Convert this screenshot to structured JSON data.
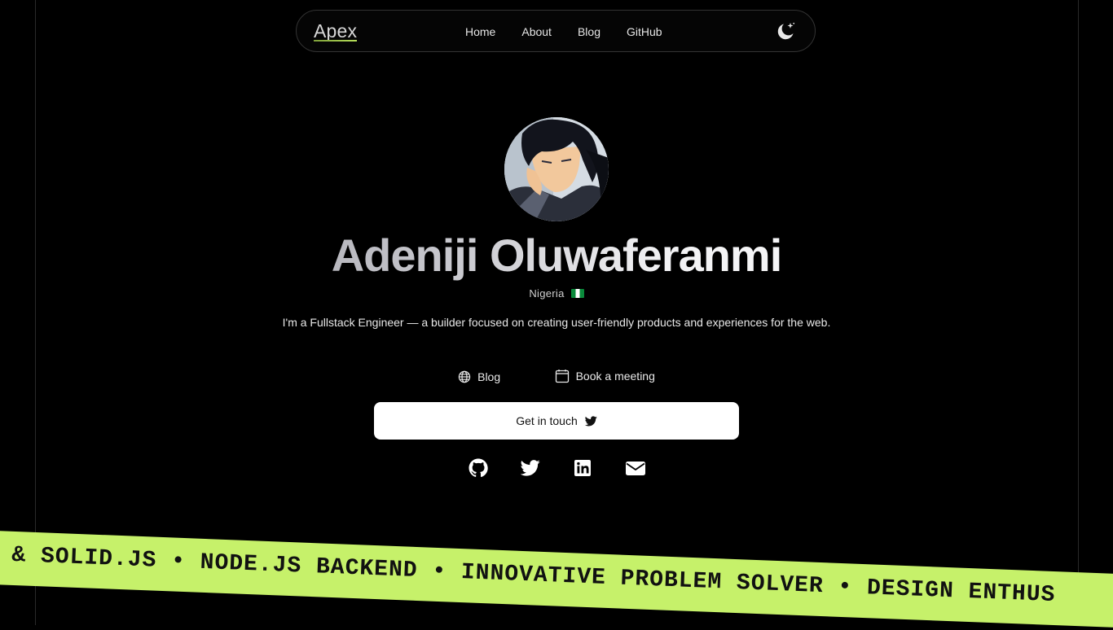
{
  "nav": {
    "brand": "Apex",
    "links": [
      "Home",
      "About",
      "Blog",
      "GitHub"
    ],
    "theme_icon": "moon-sparkle-icon"
  },
  "hero": {
    "name": "Adeniji Oluwaferanmi",
    "location": "Nigeria",
    "flag": "nigeria-flag-icon",
    "bio": "I'm a Fullstack Engineer — a builder focused on creating user-friendly products and experiences for the web.",
    "links": {
      "blog": "Blog",
      "meeting": "Book a meeting"
    },
    "cta": "Get in touch",
    "socials": [
      "github-icon",
      "twitter-icon",
      "linkedin-icon",
      "mail-icon"
    ]
  },
  "marquee": {
    "text": "T & SOLID.JS • NODE.JS BACKEND • INNOVATIVE PROBLEM SOLVER • DESIGN ENTHUS"
  },
  "colors": {
    "background": "#000000",
    "accent": "#c6f16a",
    "cta_bg": "#ffffff"
  }
}
